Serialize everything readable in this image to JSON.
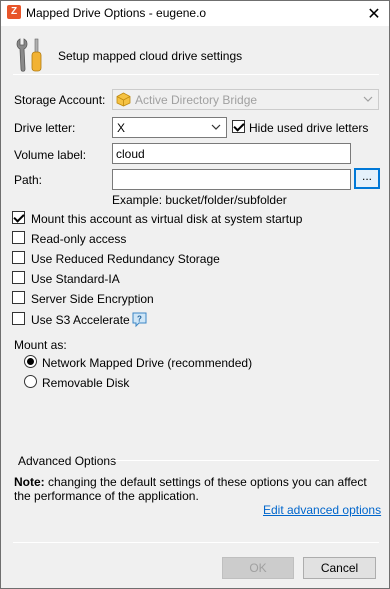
{
  "window": {
    "title": "Mapped Drive Options - eugene.o",
    "close_glyph": "✕"
  },
  "header": {
    "text": "Setup mapped cloud drive settings",
    "icon": "tools-icon"
  },
  "storage_account": {
    "label": "Storage Account:",
    "value": "Active Directory Bridge",
    "disabled": true
  },
  "drive_letter": {
    "label": "Drive letter:",
    "value": "X",
    "hide_used": {
      "label": "Hide used drive letters",
      "checked": true
    }
  },
  "volume_label": {
    "label": "Volume label:",
    "value": "cloud"
  },
  "path": {
    "label": "Path:",
    "value": "",
    "browse_label": "...",
    "example": "Example: bucket/folder/subfolder"
  },
  "options": [
    {
      "label": "Mount this account as virtual disk at system startup",
      "checked": true
    },
    {
      "label": "Read-only access",
      "checked": false
    },
    {
      "label": "Use Reduced Redundancy Storage",
      "checked": false
    },
    {
      "label": "Use Standard-IA",
      "checked": false
    },
    {
      "label": "Server Side Encryption",
      "checked": false
    },
    {
      "label": "Use S3 Accelerate",
      "checked": false
    }
  ],
  "mount_as": {
    "label": "Mount as:",
    "choices": [
      {
        "label": "Network Mapped Drive (recommended)",
        "selected": true
      },
      {
        "label": "Removable Disk",
        "selected": false
      }
    ]
  },
  "advanced": {
    "group_label": "Advanced Options",
    "note_bold": "Note:",
    "note_text": " changing the default settings of these options you can affect the performance of the application.",
    "link": "Edit advanced options"
  },
  "buttons": {
    "ok": "OK",
    "cancel": "Cancel"
  }
}
